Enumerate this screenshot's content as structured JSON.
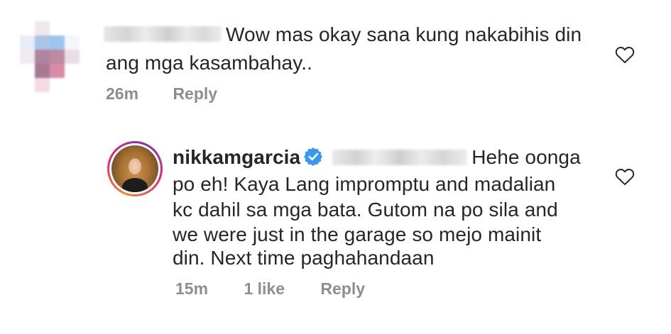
{
  "comments": [
    {
      "text_line1": "Wow mas okay sana kung nakabihis din",
      "text_line2": "ang mga kasambahay..",
      "time": "26m",
      "reply_label": "Reply"
    },
    {
      "username": "nikkamgarcia",
      "text_line1": "Hehe oonga",
      "text_line2": "po eh! Kaya Lang impromptu and madalian",
      "text_line3": "kc dahil sa mga bata. Gutom na po sila and",
      "text_line4": "we were just in the garage so mejo mainit",
      "text_line5": "din. Next time paghahandaan",
      "time": "15m",
      "likes": "1 like",
      "reply_label": "Reply"
    }
  ],
  "colors": {
    "text": "#262626",
    "meta": "#8e8e8e",
    "verified": "#3897f0"
  }
}
